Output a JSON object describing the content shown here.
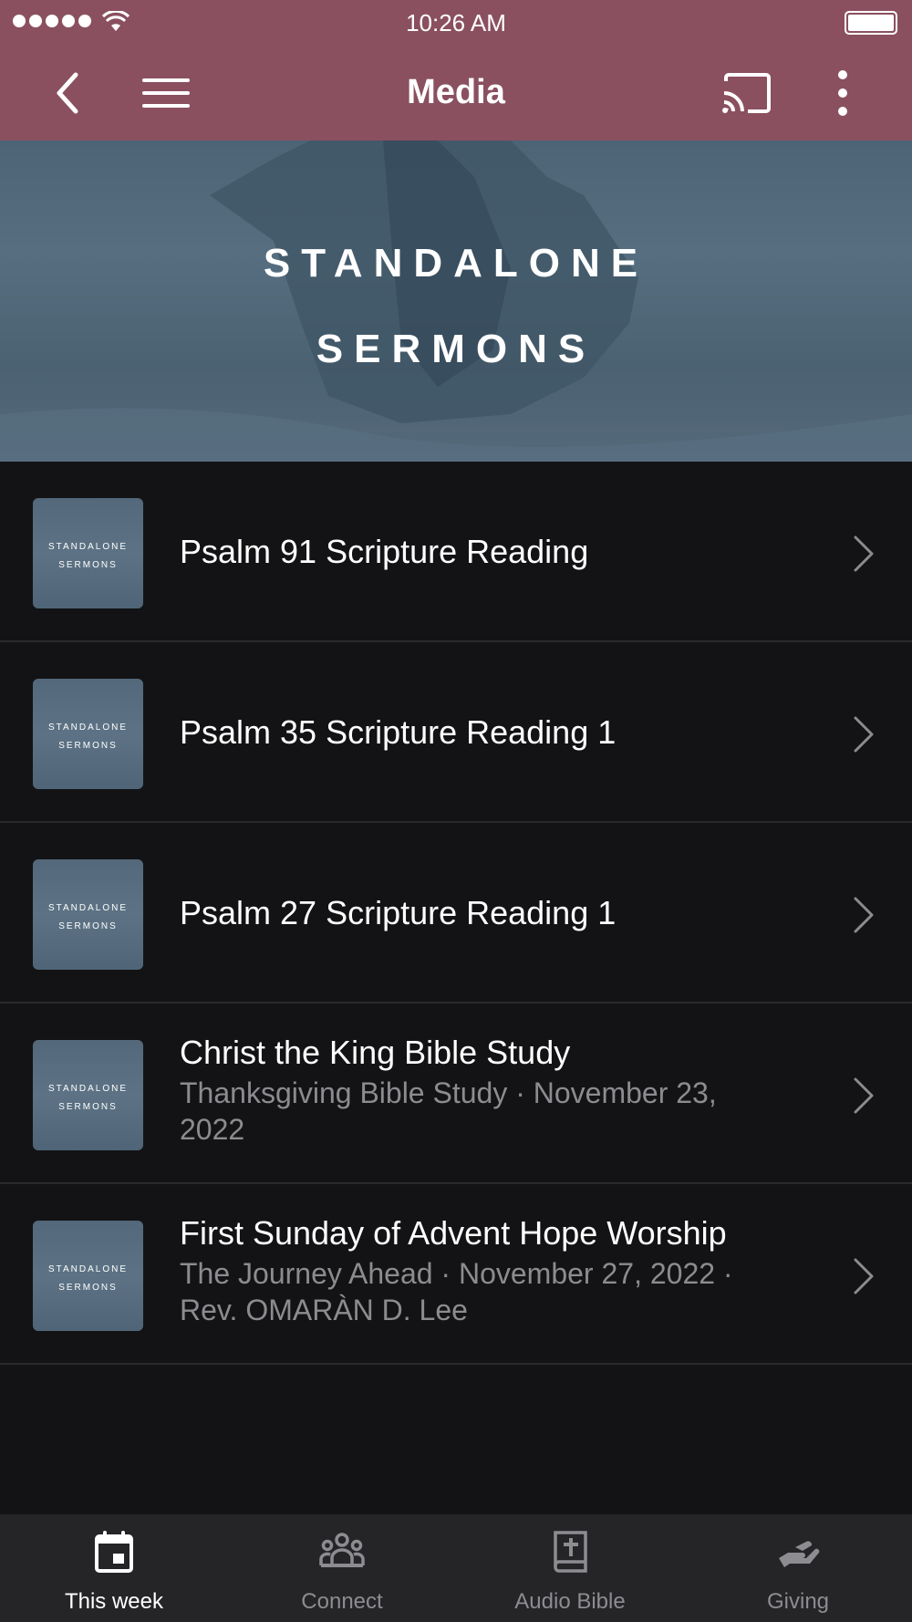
{
  "status_bar": {
    "time": "10:26 AM"
  },
  "app_bar": {
    "title": "Media",
    "accent_color": "#8a5060"
  },
  "hero": {
    "line1": "STANDALONE",
    "line2": "SERMONS"
  },
  "thumbnail": {
    "line1": "STANDALONE",
    "line2": "SERMONS"
  },
  "items": [
    {
      "title": "Psalm 91 Scripture Reading",
      "subtitle": ""
    },
    {
      "title": "Psalm 35 Scripture Reading 1",
      "subtitle": ""
    },
    {
      "title": "Psalm 27 Scripture Reading 1",
      "subtitle": ""
    },
    {
      "title": "Christ the King Bible Study",
      "subtitle": "Thanksgiving Bible Study · November 23, 2022"
    },
    {
      "title": "First Sunday of Advent Hope Worship",
      "subtitle": "The Journey Ahead · November 27, 2022 · Rev. OMARÀN D. Lee"
    }
  ],
  "bottom_nav": [
    {
      "label": "This week",
      "icon": "calendar-icon",
      "active": true
    },
    {
      "label": "Connect",
      "icon": "people-icon",
      "active": false
    },
    {
      "label": "Audio Bible",
      "icon": "bible-icon",
      "active": false
    },
    {
      "label": "Giving",
      "icon": "giving-hand-icon",
      "active": false
    }
  ]
}
